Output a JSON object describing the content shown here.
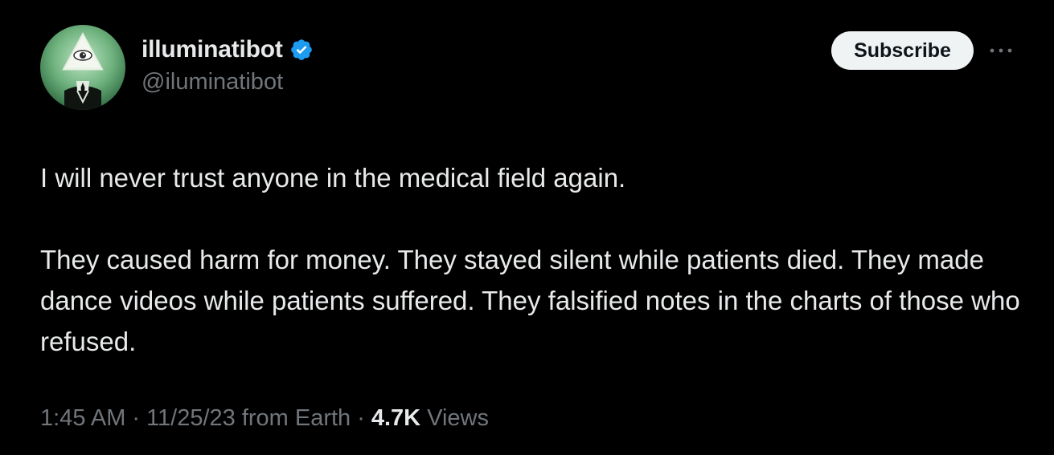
{
  "author": {
    "display_name": "illuminatibot",
    "handle": "@iluminatibot",
    "verified": true,
    "avatar_icon": "illuminati-eye-pyramid-avatar"
  },
  "actions": {
    "subscribe_label": "Subscribe",
    "more_icon": "more-horizontal-icon"
  },
  "tweet": {
    "paragraphs": [
      "I will never trust anyone in the medical field again.",
      "They caused harm for money. They stayed silent while patients died. They made dance videos while patients suffered. They falsified notes in the charts of those who refused."
    ]
  },
  "meta": {
    "time": "1:45 AM",
    "separator": "·",
    "date": "11/25/23",
    "source": "from Earth",
    "views_count": "4.7K",
    "views_label": "Views"
  },
  "colors": {
    "background": "#000000",
    "text_primary": "#e7e9ea",
    "text_secondary": "#71767b",
    "verified_blue": "#1d9bf0",
    "button_bg": "#eff3f4"
  }
}
